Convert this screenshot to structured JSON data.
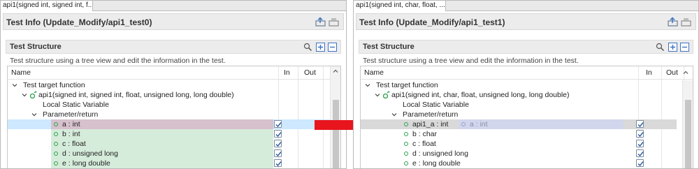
{
  "colors": {
    "selected_row_left": "#d6c1cd",
    "selected_row_right": "#d9d9d9",
    "green_rows": "#d6ecdb",
    "selected_full": "#cde8ff",
    "arrow": "#e8151d",
    "param_dot": "#2aa14a"
  },
  "left": {
    "tab_label": "api1(signed int, signed int, f...",
    "info_title": "Test Info (Update_Modify/api1_test0)",
    "section_title": "Test Structure",
    "section_desc": "Test structure using a tree view and edit the information in the test.",
    "headers": {
      "name": "Name",
      "in": "In",
      "out": "Out"
    },
    "rows": {
      "target": "Test target function",
      "function": "api1(signed int, signed int, float, unsigned long, long double)",
      "local_static": "Local Static Variable",
      "param_return": "Parameter/return",
      "p_a": "a  :  int",
      "p_b": "b  :  int",
      "p_c": "c  :  float",
      "p_d": "d  :  unsigned long",
      "p_e": "e  :  long double"
    }
  },
  "right": {
    "tab_label": "api1(signed int, char, float, ...",
    "info_title": "Test Info (Update_Modify/api1_test1)",
    "section_title": "Test Structure",
    "section_desc": "Test structure using a tree view and edit the information in the test.",
    "headers": {
      "name": "Name",
      "in": "In",
      "out": "Out"
    },
    "rows": {
      "target": "Test target function",
      "function": "api1(signed int, char, float, unsigned long, long double)",
      "local_static": "Local Static Variable",
      "param_return": "Parameter/return",
      "p_a": "api1_a  :  int",
      "p_a_old": "a  :  int",
      "p_b": "b  :  char",
      "p_c": "c  :  float",
      "p_d": "d  :  unsigned long",
      "p_e": "e  :  long double"
    }
  }
}
